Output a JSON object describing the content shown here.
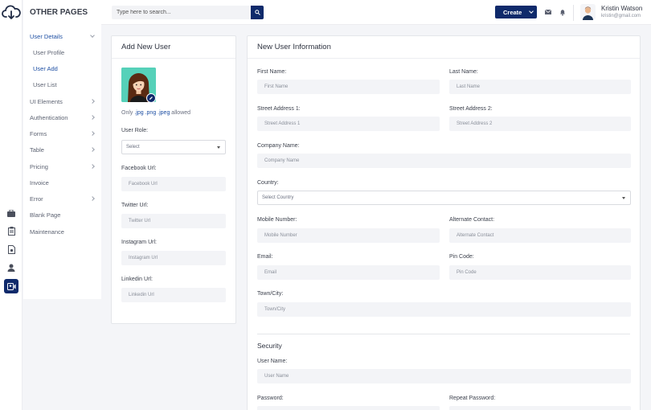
{
  "brand": {
    "section_title": "OTHER PAGES",
    "logo_icon": "cloud-download-icon"
  },
  "rail": {
    "icons": [
      "briefcase-icon",
      "clipboard-icon",
      "document-icon",
      "user-icon",
      "id-card-icon"
    ],
    "active_color": "#0f2a6b"
  },
  "menu": {
    "user_details": "User Details",
    "user_profile": "User Profile",
    "user_add": "User Add",
    "user_list": "User List",
    "ui_elements": "UI Elements",
    "authentication": "Authentication",
    "forms": "Forms",
    "table": "Table",
    "pricing": "Pricing",
    "invoice": "Invoice",
    "error": "Error",
    "blank_page": "Blank Page",
    "maintenance": "Maintenance"
  },
  "topbar": {
    "search_placeholder": "Type here to search...",
    "create_label": "Create",
    "user_name": "Kristin Watson",
    "user_email": "kristin@gmail.com"
  },
  "add_user": {
    "title": "Add New User",
    "allowed_prefix": "Only",
    "allowed_ext": ".jpg .png .jpeg",
    "allowed_suffix": "allowed",
    "role_label": "User Role:",
    "role_value": "Select",
    "facebook_label": "Facebook Url:",
    "facebook_placeholder": "Facebook Url",
    "twitter_label": "Twitter Url:",
    "twitter_placeholder": "Twitter Url",
    "instagram_label": "Instagram Url:",
    "instagram_placeholder": "Instagram Url",
    "linkedin_label": "Linkedin Url:",
    "linkedin_placeholder": "Linkedin Url"
  },
  "user_info": {
    "title": "New User Information",
    "first_name_label": "First Name:",
    "first_name_placeholder": "First Name",
    "last_name_label": "Last Name:",
    "last_name_placeholder": "Last Name",
    "street1_label": "Street Address 1:",
    "street1_placeholder": "Street Address 1",
    "street2_label": "Street Address 2:",
    "street2_placeholder": "Street Address 2",
    "company_label": "Company Name:",
    "company_placeholder": "Company Name",
    "country_label": "Country:",
    "country_value": "Select Country",
    "mobile_label": "Mobile Number:",
    "mobile_placeholder": "Mobile Number",
    "alt_contact_label": "Alternate Contact:",
    "alt_contact_placeholder": "Alternate Contact",
    "email_label": "Email:",
    "email_placeholder": "Email",
    "pin_label": "Pin Code:",
    "pin_placeholder": "Pin Code",
    "town_label": "Town/City:",
    "town_placeholder": "Town/City",
    "security_title": "Security",
    "username_label": "User Name:",
    "username_placeholder": "User Name",
    "password_label": "Password:",
    "repeat_password_label": "Repeat Password:"
  }
}
